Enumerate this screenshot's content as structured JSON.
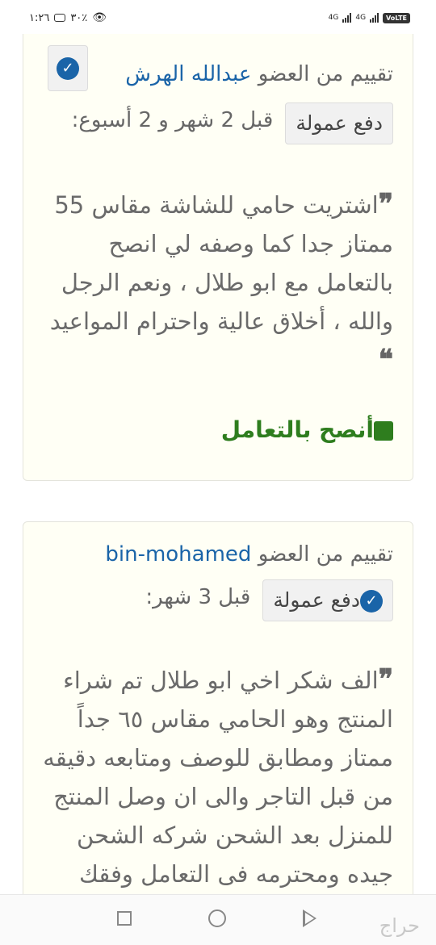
{
  "status_bar": {
    "time": "١:٢٦",
    "battery": "٣٠٪",
    "network_1": "4G",
    "network_2": "4G",
    "volte": "VoLTE"
  },
  "reviews": [
    {
      "prefix": "تقييم من العضو",
      "member": "عبدالله الهرش",
      "commission_label": "دفع عمولة",
      "time": "قبل 2 شهر و 2 أسبوع:",
      "text": "اشتريت حامي للشاشة مقاس 55 ممتاز جدا كما وصفه لي انصح بالتعامل مع ابو طلال ، ونعم الرجل والله ، أخلاق عالية واحترام المواعيد",
      "recommendation": "أنصح بالتعامل"
    },
    {
      "prefix": "تقييم من العضو",
      "member": "bin-mohamed",
      "commission_label": "دفع عمولة",
      "time": "قبل 3 شهر:",
      "text": "الف شكر اخي ابو طلال تم شراء المنتج وهو الحامي مقاس ٦٥ جداً ممتاز ومطابق للوصف ومتابعه دقيقه من قبل التاجر والى ان وصل المنتج للمنزل بعد الشحن شركه الشحن جيده ومحترمه فى التعامل وفقك"
    }
  ],
  "watermark": "حراج",
  "colors": {
    "link": "#1a64a8",
    "recommend": "#2e7d1e",
    "card_bg": "#fffff5"
  },
  "icons": {
    "quote_open": "❞",
    "quote_close": "❝",
    "check": "✓"
  }
}
